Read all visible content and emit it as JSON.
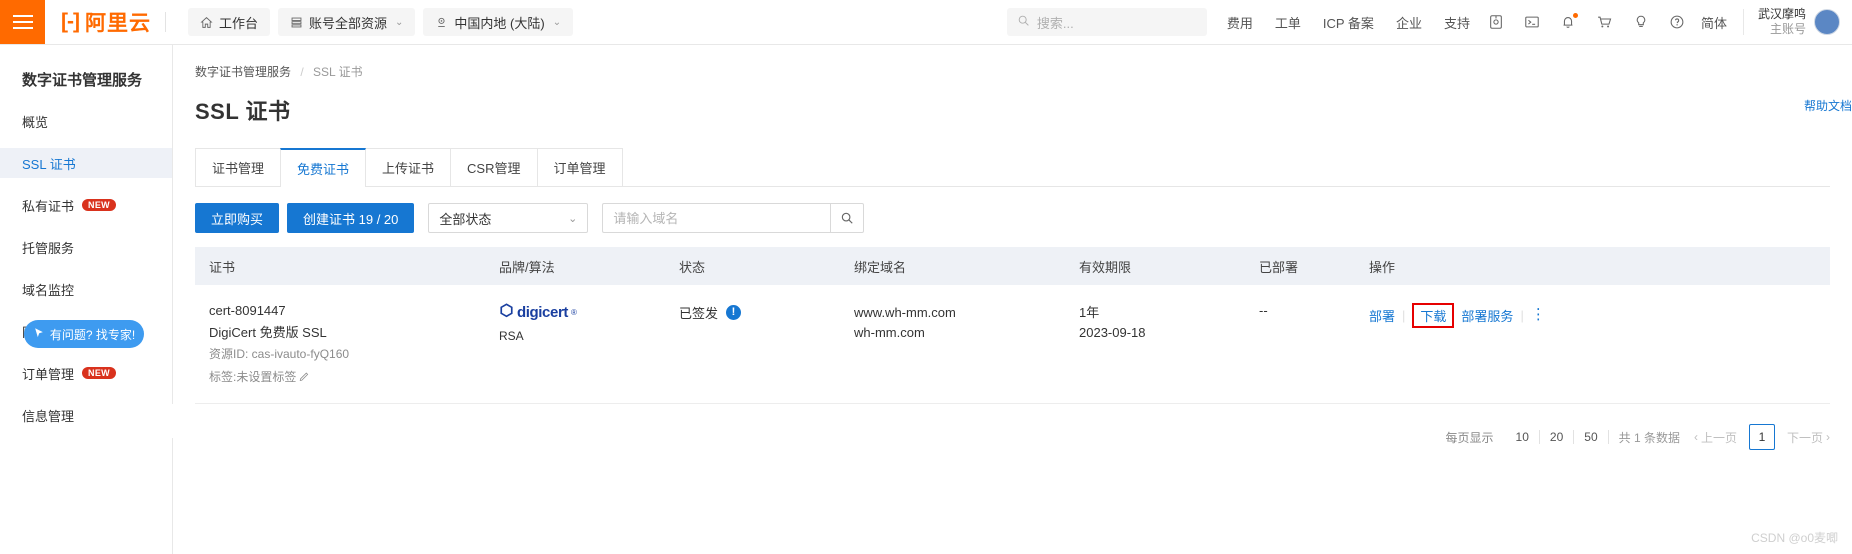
{
  "topbar": {
    "menu_icon": "hamburger-icon",
    "brand": "阿里云",
    "workbench": "工作台",
    "resources": "账号全部资源",
    "region": "中国内地 (大陆)",
    "search_placeholder": "搜索...",
    "menu": [
      "费用",
      "工单",
      "ICP 备案",
      "企业",
      "支持"
    ],
    "icons": [
      "app-icon",
      "terminal-icon",
      "bell-icon",
      "cart-icon",
      "lightbulb-icon",
      "help-icon"
    ],
    "lang": "简体",
    "user_name": "武汉摩鸣",
    "user_role": "主账号"
  },
  "sidebar": {
    "title": "数字证书管理服务",
    "items": [
      {
        "label": "概览",
        "badge": ""
      },
      {
        "label": "SSL 证书",
        "badge": ""
      },
      {
        "label": "私有证书",
        "badge": "NEW"
      },
      {
        "label": "托管服务",
        "badge": ""
      },
      {
        "label": "域名监控",
        "badge": ""
      },
      {
        "label": "网站代理HTTPS",
        "badge": ""
      },
      {
        "label": "订单管理",
        "badge": "NEW"
      },
      {
        "label": "信息管理",
        "badge": ""
      }
    ],
    "expert_button": "有问题? 找专家!"
  },
  "breadcrumb": {
    "parent": "数字证书管理服务",
    "current": "SSL 证书"
  },
  "help_doc": "帮助文档",
  "page_title": "SSL 证书",
  "tabs": [
    {
      "label": "证书管理"
    },
    {
      "label": "免费证书"
    },
    {
      "label": "上传证书"
    },
    {
      "label": "CSR管理"
    },
    {
      "label": "订单管理"
    }
  ],
  "toolbar": {
    "buy_now": "立即购买",
    "create_cert": "创建证书 19 / 20",
    "status_filter": "全部状态",
    "domain_placeholder": "请输入域名",
    "domain_value": ""
  },
  "table": {
    "headers": [
      "证书",
      "品牌/算法",
      "状态",
      "绑定域名",
      "有效期限",
      "已部署",
      "操作"
    ],
    "rows": [
      {
        "cert_id": "cert-8091447",
        "cert_name": "DigiCert 免费版 SSL",
        "resource_id": "资源ID: cas-ivauto-fyQ160",
        "tag": "标签:未设置标签",
        "brand": "digicert",
        "algorithm": "RSA",
        "status": "已签发",
        "domains": [
          "www.wh-mm.com",
          "wh-mm.com"
        ],
        "valid_period": "1年",
        "valid_date": "2023-09-18",
        "deployed": "--",
        "actions": [
          "部署",
          "下载",
          "部署服务"
        ]
      }
    ]
  },
  "pagination": {
    "per_page_label": "每页显示",
    "sizes": [
      "10",
      "20",
      "50"
    ],
    "total": "共 1 条数据",
    "prev": "上一页",
    "page": "1",
    "next": "下一页"
  },
  "watermark": "CSDN @o0麦唧",
  "colors": {
    "brand": "#ff6a00",
    "accent": "#1677d2",
    "highlight": "#e60000",
    "badge": "#d9321d"
  }
}
